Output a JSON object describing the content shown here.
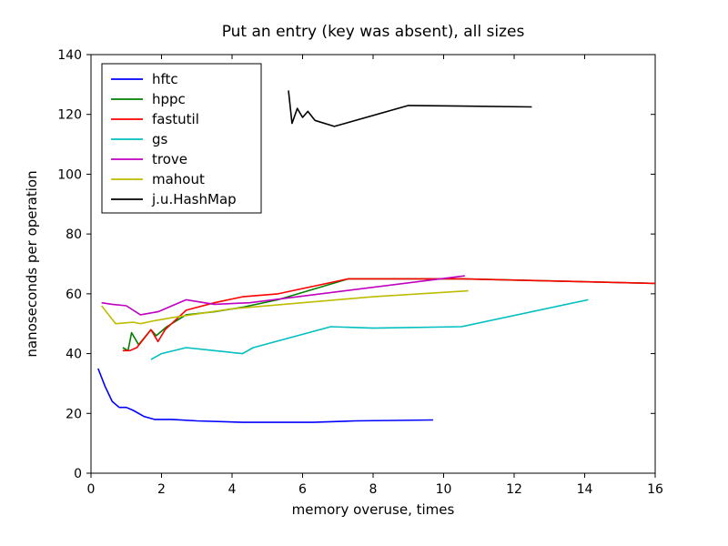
{
  "chart_data": {
    "type": "line",
    "title": "Put an entry (key was absent), all sizes",
    "xlabel": "memory overuse, times",
    "ylabel": "nanoseconds per operation",
    "xlim": [
      0,
      16
    ],
    "ylim": [
      0,
      140
    ],
    "xticks": [
      0,
      2,
      4,
      6,
      8,
      10,
      12,
      14,
      16
    ],
    "yticks": [
      0,
      20,
      40,
      60,
      80,
      100,
      120,
      140
    ],
    "series": [
      {
        "name": "hftc",
        "color": "#0000ff",
        "x": [
          0.2,
          0.4,
          0.6,
          0.8,
          1.0,
          1.2,
          1.5,
          1.8,
          2.3,
          3.0,
          4.3,
          5.3,
          6.3,
          7.5,
          9.7
        ],
        "y": [
          35,
          29,
          24,
          22,
          22,
          21,
          19,
          18,
          18,
          17.5,
          17,
          17,
          17,
          17.5,
          17.8
        ]
      },
      {
        "name": "hppc",
        "color": "#008000",
        "x": [
          0.9,
          1.05,
          1.15,
          1.35,
          1.7,
          1.85,
          2.15,
          2.7,
          3.5,
          4.3,
          5.3,
          7.3,
          10.5,
          16.0
        ],
        "y": [
          42,
          41,
          47,
          43,
          48,
          46,
          49,
          53,
          54,
          55.5,
          58,
          65,
          65,
          63.5
        ]
      },
      {
        "name": "fastutil",
        "color": "#ff0000",
        "x": [
          0.9,
          1.1,
          1.3,
          1.7,
          1.9,
          2.1,
          2.7,
          3.5,
          4.3,
          5.3,
          7.3,
          10.5,
          16.0
        ],
        "y": [
          41,
          41,
          42,
          48,
          44,
          48,
          54.5,
          57,
          59,
          60,
          65,
          65,
          63.5
        ]
      },
      {
        "name": "gs",
        "color": "#00bfbf",
        "x": [
          1.7,
          2.0,
          2.7,
          3.5,
          4.3,
          4.6,
          6.8,
          8.0,
          10.5,
          14.1
        ],
        "y": [
          38,
          40,
          42,
          41,
          40,
          42,
          49,
          48.5,
          49,
          58
        ]
      },
      {
        "name": "trove",
        "color": "#bf00bf",
        "x": [
          0.3,
          0.6,
          1.0,
          1.4,
          1.9,
          2.7,
          3.5,
          4.5,
          10.6
        ],
        "y": [
          57,
          56.5,
          56,
          53,
          54,
          58,
          56.5,
          57,
          66
        ]
      },
      {
        "name": "mahout",
        "color": "#bfbc00",
        "x": [
          0.3,
          0.7,
          1.2,
          1.4,
          1.8,
          2.3,
          4.0,
          6.0,
          8.0,
          10.7
        ],
        "y": [
          56,
          50,
          50.5,
          50,
          51,
          52,
          55,
          57,
          59,
          61
        ]
      },
      {
        "name": "j.u.HashMap",
        "color": "#000000",
        "x": [
          5.6,
          5.7,
          5.85,
          6.0,
          6.15,
          6.35,
          6.9,
          9.0,
          12.5
        ],
        "y": [
          128,
          117,
          122,
          119,
          121,
          118,
          116,
          123,
          122.5
        ]
      }
    ],
    "legend_position": "upper left"
  }
}
